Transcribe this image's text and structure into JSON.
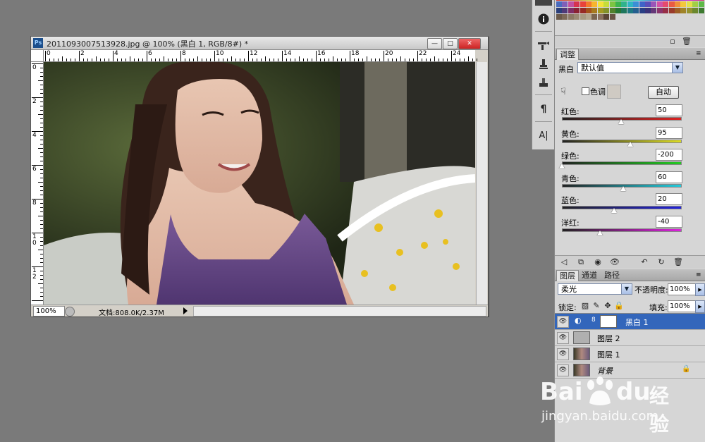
{
  "document": {
    "title": "2011093007513928.jpg @ 100% (黑白 1, RGB/8#) *",
    "ps_icon": "Ps",
    "minimize": "—",
    "restore": "□",
    "close": "✕",
    "zoom": "100%",
    "doc_info": "文档:808.0K/2.37M",
    "ruler_h_labels": [
      "0",
      "2",
      "4",
      "6",
      "8",
      "10",
      "12",
      "14",
      "16",
      "18",
      "20",
      "22",
      "24"
    ],
    "ruler_v_labels": [
      "0",
      "2",
      "4",
      "6",
      "8",
      "10",
      "12"
    ]
  },
  "tools": {
    "items": [
      "info-icon",
      "brush-settings-icon",
      "clone-source-icon",
      "tool-presets-icon",
      "paragraph-icon",
      "character-icon"
    ],
    "paragraph_glyph": "¶",
    "character_glyph": "A|"
  },
  "adjustments": {
    "tab_label": "调整",
    "preset_label": "黑白",
    "preset_value": "默认值",
    "tint_label": "色调",
    "auto_button": "自动",
    "sliders": [
      {
        "label": "红色:",
        "value": "50",
        "level": 0.5,
        "gradient": "linear-gradient(90deg,#222,#d22)"
      },
      {
        "label": "黄色:",
        "value": "95",
        "level": 0.58,
        "gradient": "linear-gradient(90deg,#222,#dd2)"
      },
      {
        "label": "绿色:",
        "value": "-200",
        "level": 0.0,
        "gradient": "linear-gradient(90deg,#222,#2c2)"
      },
      {
        "label": "青色:",
        "value": "60",
        "level": 0.52,
        "gradient": "linear-gradient(90deg,#222,#2cd)"
      },
      {
        "label": "蓝色:",
        "value": "20",
        "level": 0.44,
        "gradient": "linear-gradient(90deg,#222,#22d)"
      },
      {
        "label": "洋红:",
        "value": "-40",
        "level": 0.32,
        "gradient": "linear-gradient(90deg,#222,#d2d)"
      }
    ]
  },
  "layers_panel": {
    "tabs": [
      "图层",
      "通道",
      "路径"
    ],
    "blend_mode": "柔光",
    "opacity_label": "不透明度:",
    "opacity_value": "100%",
    "lock_label": "锁定:",
    "fill_label": "填充:",
    "fill_value": "100%",
    "layers": [
      {
        "name": "黑白 1",
        "selected": true
      },
      {
        "name": "图层 2",
        "selected": false
      },
      {
        "name": "图层 1",
        "selected": false
      },
      {
        "name": "背景",
        "selected": false
      }
    ]
  },
  "watermark": {
    "brand": "Bai",
    "brand2": "du",
    "cn": "经验",
    "url": "jingyan.baidu.com"
  },
  "colors": {
    "selection": "#3366bb",
    "desktop": "#7a7a7a",
    "panel": "#d6d6d6"
  }
}
